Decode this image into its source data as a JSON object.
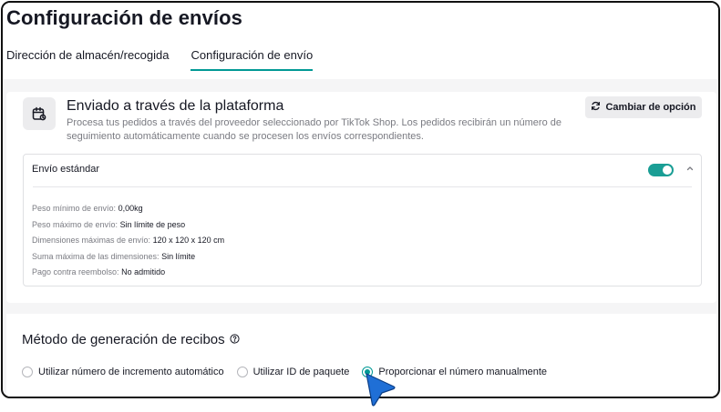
{
  "header": {
    "title": "Configuración de envíos"
  },
  "tabs": [
    {
      "label": "Dirección de almacén/recogida",
      "active": false
    },
    {
      "label": "Configuración de envío",
      "active": true
    }
  ],
  "shipping_card": {
    "icon": "shipping-box-icon",
    "title": "Enviado a través de la plataforma",
    "description": "Procesa tus pedidos a través del proveedor seleccionado por TikTok Shop. Los pedidos recibirán un número de seguimiento automáticamente cuando se procesen los envíos correspondientes.",
    "change_button": "Cambiar de opción"
  },
  "standard_shipping": {
    "title": "Envío estándar",
    "enabled": true,
    "specs": [
      {
        "label": "Peso mínimo de envío:",
        "value": "0,00kg"
      },
      {
        "label": "Peso máximo de envío:",
        "value": "Sin límite de peso"
      },
      {
        "label": "Dimensiones máximas de envío:",
        "value": "120 x 120 x 120 cm"
      },
      {
        "label": "Suma máxima de las dimensiones:",
        "value": "Sin límite"
      },
      {
        "label": "Pago contra reembolso:",
        "value": "No admitido"
      }
    ]
  },
  "receipt_method": {
    "title": "Método de generación de recibos",
    "options": [
      {
        "label": "Utilizar número de incremento automático",
        "checked": false
      },
      {
        "label": "Utilizar ID de paquete",
        "checked": false
      },
      {
        "label": "Proporcionar el número manualmente",
        "checked": true
      }
    ]
  },
  "colors": {
    "accent": "#009995",
    "toggle": "#1a9e95",
    "cursor": "#1f6fd6"
  }
}
